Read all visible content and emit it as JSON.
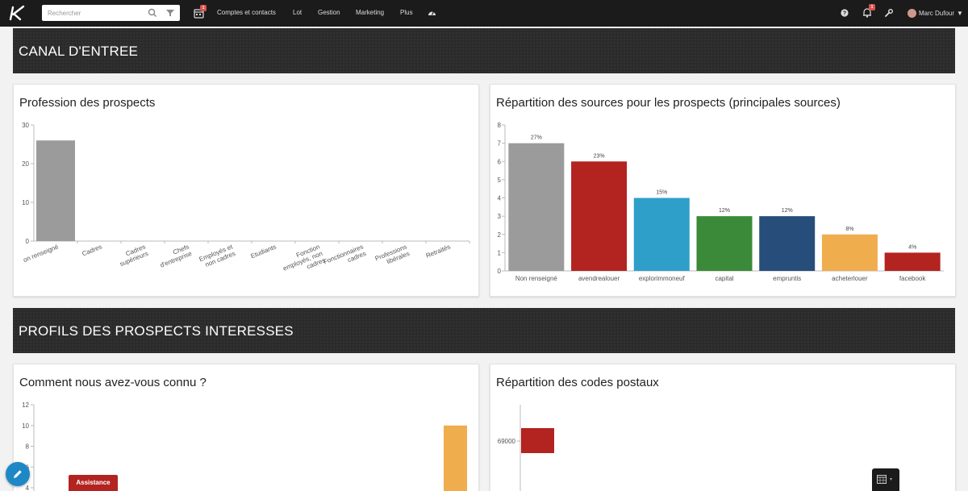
{
  "topbar": {
    "search_placeholder": "Rechercher",
    "nav": [
      "Comptes et contacts",
      "Lot",
      "Gestion",
      "Marketing",
      "Plus"
    ],
    "calendar_badge": "1",
    "notif_badge": "1",
    "user_name": "Marc Dufour"
  },
  "sections": {
    "canal": "CANAL D'ENTREE",
    "profils": "PROFILS DES PROSPECTS INTERESSES"
  },
  "cards": {
    "profession": "Profession des prospects",
    "sources": "Répartition des sources pour les prospects (principales sources)",
    "connu": "Comment nous avez-vous connu ?",
    "postaux": "Répartition des codes postaux"
  },
  "floating": {
    "assistance": "Assistance"
  },
  "colors": {
    "topbar": "#1b1b1b",
    "banner": "#2b2b2b",
    "accent_blue": "#1e88c7",
    "assist_red": "#b32320"
  },
  "chart_data": [
    {
      "type": "bar",
      "title": "Profession des prospects",
      "categories": [
        "on renseigné",
        "Cadres",
        "Cadres supérieurs",
        "Chefs d'entreprise",
        "Employés et non cadres",
        "Etudiants",
        "Fonction employés, non cadres",
        "Fonctionnaires cadres",
        "Professions libérales",
        "Retraités"
      ],
      "category_lines": [
        [
          "on renseigné"
        ],
        [
          "Cadres"
        ],
        [
          "Cadres",
          "supérieurs"
        ],
        [
          "Chefs",
          "d'entreprise"
        ],
        [
          "Employés et",
          "non cadres"
        ],
        [
          "Etudiants"
        ],
        [
          "Fonction",
          "employés, non",
          "cadres"
        ],
        [
          "Fonctionnaires",
          "cadres"
        ],
        [
          "Professions",
          "libérales"
        ],
        [
          "Retraités"
        ]
      ],
      "values": [
        26,
        0,
        0,
        0,
        0,
        0,
        0,
        0,
        0,
        0
      ],
      "color": "#9b9b9b",
      "ylim": [
        0,
        30
      ],
      "yticks": [
        0,
        10,
        20,
        30
      ]
    },
    {
      "type": "bar",
      "title": "Répartition des sources pour les prospects (principales sources)",
      "categories": [
        "Non renseigné",
        "avendrealouer",
        "explorimmoneuf",
        "capital",
        "empruntis",
        "acheterlouer",
        "facebook"
      ],
      "values": [
        7,
        6,
        4,
        3,
        3,
        2,
        1
      ],
      "labels": [
        "27%",
        "23%",
        "15%",
        "12%",
        "12%",
        "8%",
        "4%"
      ],
      "colors": [
        "#9b9b9b",
        "#b32320",
        "#2e9fc9",
        "#3a8a3a",
        "#274e7a",
        "#f0ad4e",
        "#b32320"
      ],
      "ylim": [
        0,
        8
      ],
      "yticks": [
        0,
        1,
        2,
        3,
        4,
        5,
        6,
        7,
        8
      ]
    },
    {
      "type": "bar",
      "title": "Comment nous avez-vous connu ?",
      "values": [
        10
      ],
      "color": "#f0ad4e",
      "ylim": [
        4,
        12
      ],
      "yticks": [
        4,
        6,
        8,
        10,
        12
      ]
    },
    {
      "type": "bar",
      "title": "Répartition des codes postaux",
      "categories": [
        "69000"
      ],
      "color": "#b32320"
    }
  ]
}
